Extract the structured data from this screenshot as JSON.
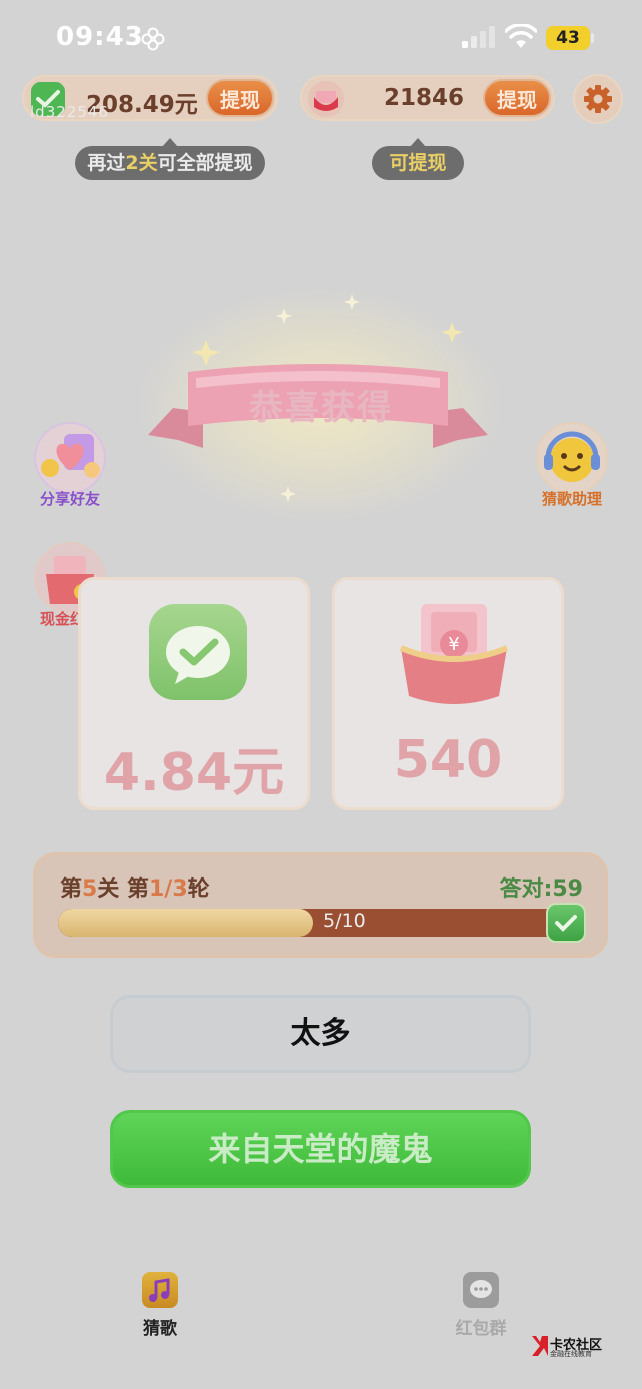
{
  "status_bar": {
    "time": "09:43",
    "battery": "43"
  },
  "top": {
    "cash": {
      "value": "208.49元",
      "button": "提现"
    },
    "coins": {
      "value": "21846",
      "button": "提现"
    },
    "watermark": "ld322546",
    "tip_cash": {
      "prefix": "再过",
      "highlight": "2关",
      "suffix": "可全部提现"
    },
    "tip_coins": "可提现"
  },
  "celebration": {
    "banner": "恭喜获得"
  },
  "side": {
    "share": "分享好友",
    "assistant": "猜歌助理",
    "cash_redpacket": "现金红包"
  },
  "rewards": {
    "cash": "4.84元",
    "coins": "540"
  },
  "progress": {
    "level_prefix": "第",
    "level": "5",
    "level_suffix": "关 第",
    "round": "1/3",
    "round_suffix": "轮",
    "correct": "答对:59",
    "fill_fraction": 0.5,
    "text": "5/10"
  },
  "answers": {
    "option_a": "太多",
    "option_b": "来自天堂的魔鬼"
  },
  "nav": {
    "guess": "猜歌",
    "group": "红包群"
  },
  "corner_logo": {
    "name": "卡农社区",
    "sub": "金融在线教育"
  },
  "colors": {
    "accent_orange": "#d9672a",
    "green": "#3fba39",
    "brown": "#6a3f2b"
  }
}
